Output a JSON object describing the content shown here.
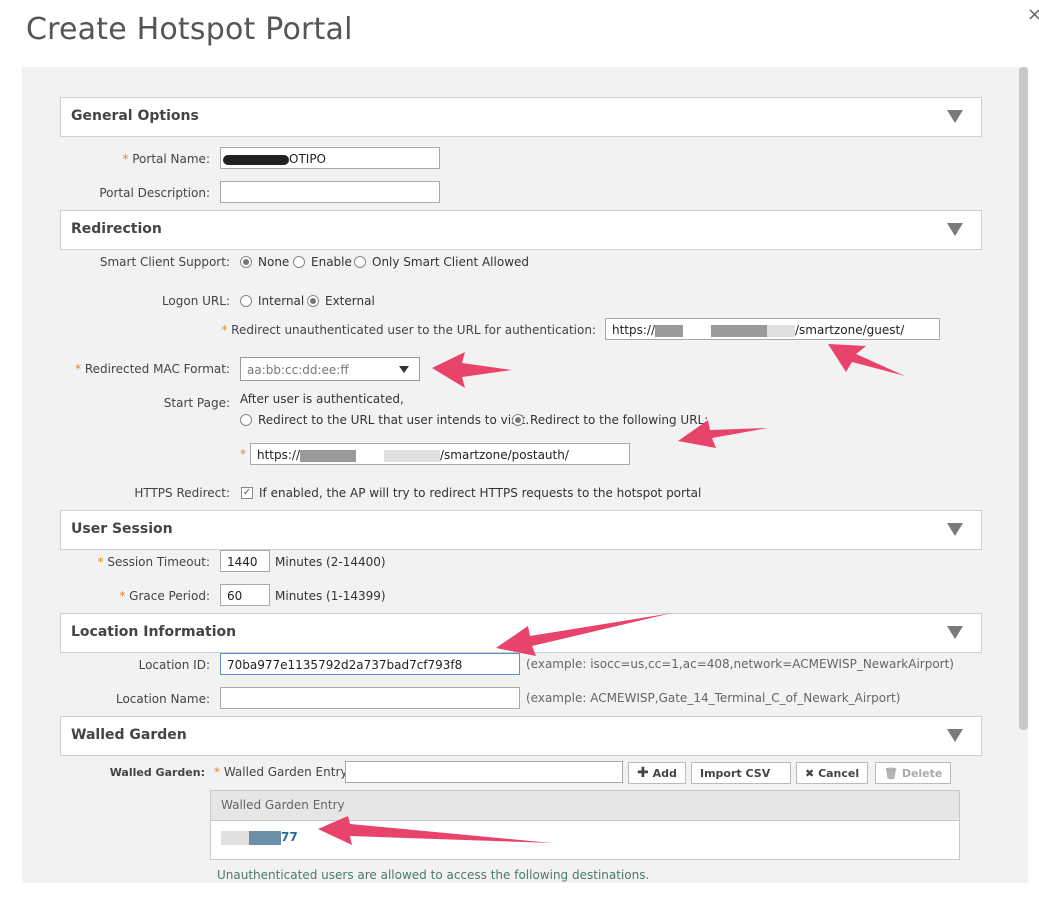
{
  "page_title": "Create Hotspot Portal",
  "close_glyph": "×",
  "sections": {
    "general": "General Options",
    "redirection": "Redirection",
    "user_session": "User Session",
    "location": "Location Information",
    "walled_garden": "Walled Garden"
  },
  "general": {
    "portal_name_label": "Portal Name:",
    "portal_name_value": "OTIPO",
    "portal_description_label": "Portal Description:",
    "portal_description_value": ""
  },
  "redirection": {
    "smart_client_label": "Smart Client Support:",
    "smart_client_options": [
      "None",
      "Enable",
      "Only Smart Client Allowed"
    ],
    "logon_url_label": "Logon URL:",
    "logon_url_options": [
      "Internal",
      "External"
    ],
    "redirect_unauth_label": "Redirect unauthenticated user to the URL for authentication:",
    "redirect_unauth_prefix": "https://",
    "redirect_unauth_suffix": "/smartzone/guest/",
    "mac_format_label": "Redirected MAC Format:",
    "mac_format_value": "aa:bb:cc:dd:ee:ff",
    "start_page_label": "Start Page:",
    "start_page_note": "After user is authenticated,",
    "start_page_options": [
      "Redirect to the URL that user intends to visit.",
      "Redirect to the following URL:"
    ],
    "start_url_prefix": "https://",
    "start_url_suffix": "/smartzone/postauth/",
    "https_redirect_label": "HTTPS Redirect:",
    "https_redirect_text": "If enabled, the AP will try to redirect HTTPS requests to the hotspot portal",
    "check_glyph": "✓"
  },
  "user_session": {
    "session_timeout_label": "Session Timeout:",
    "session_timeout_value": "1440",
    "session_timeout_units": "Minutes (2-14400)",
    "grace_period_label": "Grace Period:",
    "grace_period_value": "60",
    "grace_period_units": "Minutes (1-14399)"
  },
  "location": {
    "location_id_label": "Location ID:",
    "location_id_value": "70ba977e1135792d2a737bad7cf793f8",
    "location_id_example": "(example: isocc=us,cc=1,ac=408,network=ACMEWISP_NewarkAirport)",
    "location_name_label": "Location Name:",
    "location_name_value": "",
    "location_name_example": "(example: ACMEWISP,Gate_14_Terminal_C_of_Newark_Airport)"
  },
  "walled_garden": {
    "label": "Walled Garden:",
    "entry_label": "Walled Garden Entry",
    "entry_value": "",
    "add_button": "Add",
    "import_button": "Import CSV",
    "cancel_button": "Cancel",
    "delete_button": "Delete",
    "table_header": "Walled Garden Entry",
    "row_prefix": "",
    "row_suffix": "77",
    "footer_text": "Unauthenticated users are allowed to access the following destinations."
  },
  "required_mark": "*",
  "colors": {
    "accent_arrow": "#e8436a",
    "required": "#e08a2b",
    "panel_bg": "#f2f2f2"
  }
}
